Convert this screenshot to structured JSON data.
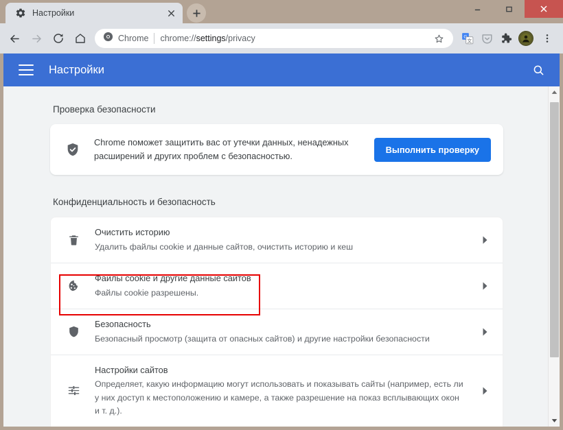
{
  "window": {
    "controls": {
      "minimize": "minimize-button",
      "maximize": "maximize-button",
      "close": "close-button"
    },
    "close_color": "#c75450",
    "frame_color": "#b3a394"
  },
  "tabs": [
    {
      "title": "Настройки",
      "favicon": "gear-icon",
      "close": "close-tab-icon"
    }
  ],
  "new_tab_label": "+",
  "toolbar": {
    "back": "back-arrow-icon",
    "forward": "forward-arrow-icon",
    "reload": "reload-icon",
    "home": "home-icon",
    "omnibox": {
      "chip_label": "Chrome",
      "chip_icon": "chrome-logo-icon",
      "url_prefix": "chrome://",
      "url_strong": "settings",
      "url_suffix": "/privacy",
      "full_url": "chrome://settings/privacy",
      "star": "bookmark-star-icon"
    },
    "extensions": [
      "google-translate-icon",
      "pocket-save-icon",
      "puzzle-extensions-icon"
    ],
    "avatar": "profile-avatar",
    "menu": "three-dot-menu-icon"
  },
  "settings_header": {
    "menu_icon": "hamburger-menu-icon",
    "title": "Настройки",
    "search_icon": "search-icon",
    "background": "#3b6fd4"
  },
  "sections": [
    {
      "title": "Проверка безопасности",
      "check_card": {
        "icon": "shield-check-icon",
        "text": "Chrome поможет защитить вас от утечки данных, ненадежных расширений и других проблем с безопасностью.",
        "button_label": "Выполнить проверку",
        "button_color": "#1a73e8"
      }
    },
    {
      "title": "Конфиденциальность и безопасность",
      "rows": [
        {
          "icon": "trash-bin-icon",
          "title": "Очистить историю",
          "subtitle": "Удалить файлы cookie и данные сайтов, очистить историю и кеш",
          "chevron": "chevron-right-icon",
          "highlighted": false
        },
        {
          "icon": "cookie-icon",
          "title": "Файлы cookie и другие данные сайтов",
          "subtitle": "Файлы cookie разрешены.",
          "chevron": "chevron-right-icon",
          "highlighted": true
        },
        {
          "icon": "shield-outline-icon",
          "title": "Безопасность",
          "subtitle": "Безопасный просмотр (защита от опасных сайтов) и другие настройки безопасности",
          "chevron": "chevron-right-icon",
          "highlighted": false
        },
        {
          "icon": "tune-sliders-icon",
          "title": "Настройки сайтов",
          "subtitle": "Определяет, какую информацию могут использовать и показывать сайты (например, есть ли у них доступ к местоположению и камере, а также разрешение на показ всплывающих окон и т. д.).",
          "chevron": "chevron-right-icon",
          "highlighted": false
        }
      ]
    }
  ],
  "highlight": {
    "color": "#e60000"
  },
  "scrollbar": {
    "up": "scroll-up-arrow-icon",
    "down": "scroll-down-arrow-icon",
    "thumb": "scrollbar-thumb"
  }
}
